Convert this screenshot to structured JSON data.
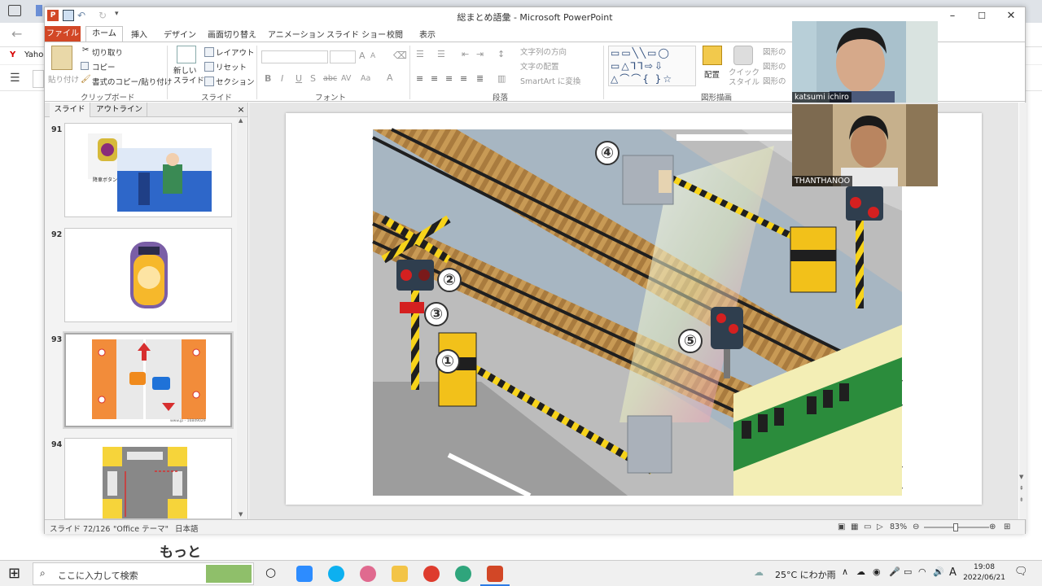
{
  "browser": {
    "bookmark_label": "Yahoo",
    "page_text": "もっと"
  },
  "window": {
    "title": "総まとめ語彙 - Microsoft PowerPoint"
  },
  "tabs": [
    {
      "label": "ファイル",
      "active": false
    },
    {
      "label": "ホーム",
      "active": true
    },
    {
      "label": "挿入"
    },
    {
      "label": "デザイン"
    },
    {
      "label": "画面切り替え"
    },
    {
      "label": "アニメーション"
    },
    {
      "label": "スライド ショー"
    },
    {
      "label": "校閲"
    },
    {
      "label": "表示"
    }
  ],
  "ribbon": {
    "clipboard": {
      "paste": "貼り付け",
      "cut": "切り取り",
      "copy": "コピー",
      "format_painter": "書式のコピー/貼り付け",
      "label": "クリップボード"
    },
    "slides": {
      "new_slide": "新しい\nスライド",
      "layout": "レイアウト",
      "reset": "リセット",
      "section": "セクション",
      "label": "スライド"
    },
    "font": {
      "label": "フォント",
      "bold": "B",
      "italic": "I",
      "underline": "U",
      "shadow": "S",
      "strike": "abc",
      "spacing": "AV",
      "case": "Aa",
      "color": "A",
      "grow": "A",
      "shrink": "A"
    },
    "paragraph": {
      "label": "段落",
      "text_direction": "文字列の方向",
      "align_text": "文字の配置",
      "smartart": "SmartArt に変換"
    },
    "drawing": {
      "label": "図形描画",
      "arrange": "配置",
      "quick_styles": "クイック\nスタイル",
      "shape_fill": "図形の",
      "shape_outline": "図形の",
      "shape_effects": "図形の"
    }
  },
  "left_pane": {
    "tab_slides": "スライド",
    "tab_outline": "アウトライン",
    "close": "×",
    "thumbnails": [
      {
        "num": "91",
        "caption": "降車ボタン"
      },
      {
        "num": "92",
        "caption": ""
      },
      {
        "num": "93",
        "caption": "www.jp - 16849029",
        "selected": true
      },
      {
        "num": "94",
        "caption": ""
      }
    ]
  },
  "slide": {
    "labels": [
      "①",
      "②",
      "③",
      "④",
      "⑤"
    ]
  },
  "status": {
    "slide_info": "スライド 72/126",
    "theme": "\"Office テーマ\"",
    "language": "日本語",
    "zoom": "83%"
  },
  "video": {
    "participant1": "katsumi ichiro",
    "participant2": "THANTHANOO"
  },
  "taskbar": {
    "search_placeholder": "ここに入力して検索",
    "weather": "25°C にわか雨",
    "ime": "A",
    "time": "19:08",
    "date": "2022/06/21"
  },
  "colors": {
    "file_tab": "#d24726",
    "rail_yellow": "#f7d31a",
    "rail_black": "#1f1f1f"
  }
}
